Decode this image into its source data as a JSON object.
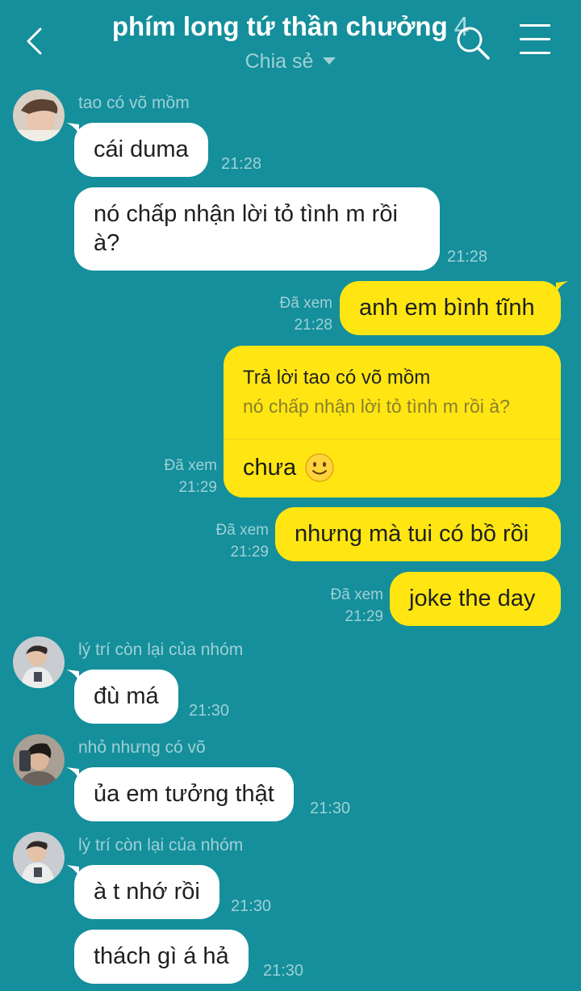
{
  "header": {
    "title": "phím long tứ thần chưởng",
    "member_count": "4",
    "subtitle": "Chia sẻ"
  },
  "messages": [
    {
      "sender": "tao có võ mồm",
      "text": "cái duma",
      "time": "21:28"
    },
    {
      "text_line1": "nó chấp nhận lời tỏ tình m rồi",
      "text_line2": "à?",
      "time": "21:28"
    },
    {
      "status": "Đã xem",
      "text": "anh em bình tĩnh",
      "time": "21:28"
    },
    {
      "status": "Đã xem",
      "reply_label": "Trả lời tao có võ mồm",
      "reply_quote": "nó chấp nhận lời tỏ tình m rồi à?",
      "text": "chưa",
      "time": "21:29"
    },
    {
      "status": "Đã xem",
      "text": "nhưng mà tui có bồ rồi",
      "time": "21:29"
    },
    {
      "status": "Đã xem",
      "text": "joke the day",
      "time": "21:29"
    },
    {
      "sender": "lý trí còn lại của nhóm",
      "text": "đù má",
      "time": "21:30"
    },
    {
      "sender": "nhỏ nhưng có võ",
      "text": "ủa em tưởng thật",
      "time": "21:30"
    },
    {
      "sender": "lý trí còn lại của nhóm",
      "text": "à t nhớ rồi",
      "time": "21:30"
    },
    {
      "text": "thách gì á hả",
      "time": "21:30"
    }
  ],
  "colors": {
    "background": "#148f9b",
    "incoming_bubble": "#ffffff",
    "outgoing_bubble": "#ffe612",
    "meta_text": "#9fd0d6"
  },
  "icons": [
    "back-arrow-icon",
    "search-icon",
    "menu-icon",
    "chevron-down-icon",
    "smile-emoji-icon"
  ]
}
